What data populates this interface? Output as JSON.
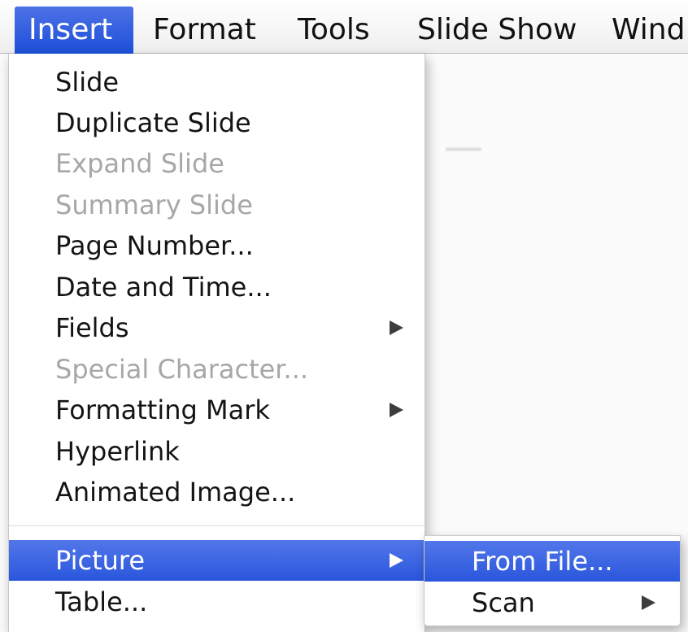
{
  "menubar": {
    "items": [
      {
        "label": "Insert",
        "active": true
      },
      {
        "label": "Format"
      },
      {
        "label": "Tools"
      },
      {
        "label": "Slide Show"
      },
      {
        "label": "Wind"
      }
    ]
  },
  "insert_menu": {
    "items": [
      {
        "label": "Slide",
        "enabled": true
      },
      {
        "label": "Duplicate Slide",
        "enabled": true
      },
      {
        "label": "Expand Slide",
        "enabled": false
      },
      {
        "label": "Summary Slide",
        "enabled": false
      },
      {
        "label": "Page Number...",
        "enabled": true
      },
      {
        "label": "Date and Time...",
        "enabled": true
      },
      {
        "label": "Fields",
        "enabled": true,
        "submenu": true
      },
      {
        "label": "Special Character...",
        "enabled": false
      },
      {
        "label": "Formatting Mark",
        "enabled": true,
        "submenu": true
      },
      {
        "label": "Hyperlink",
        "enabled": true
      },
      {
        "label": "Animated Image...",
        "enabled": true
      },
      {
        "label": "Picture",
        "enabled": true,
        "submenu": true,
        "highlighted": true
      },
      {
        "label": "Table...",
        "enabled": true
      }
    ]
  },
  "picture_submenu": {
    "items": [
      {
        "label": "From File...",
        "highlighted": true
      },
      {
        "label": "Scan",
        "submenu": true
      }
    ]
  },
  "icons": {
    "submenu_arrow": "triangle-right-icon"
  },
  "colors": {
    "highlight": "#2a56dc",
    "disabled_text": "#a7a7a7"
  }
}
